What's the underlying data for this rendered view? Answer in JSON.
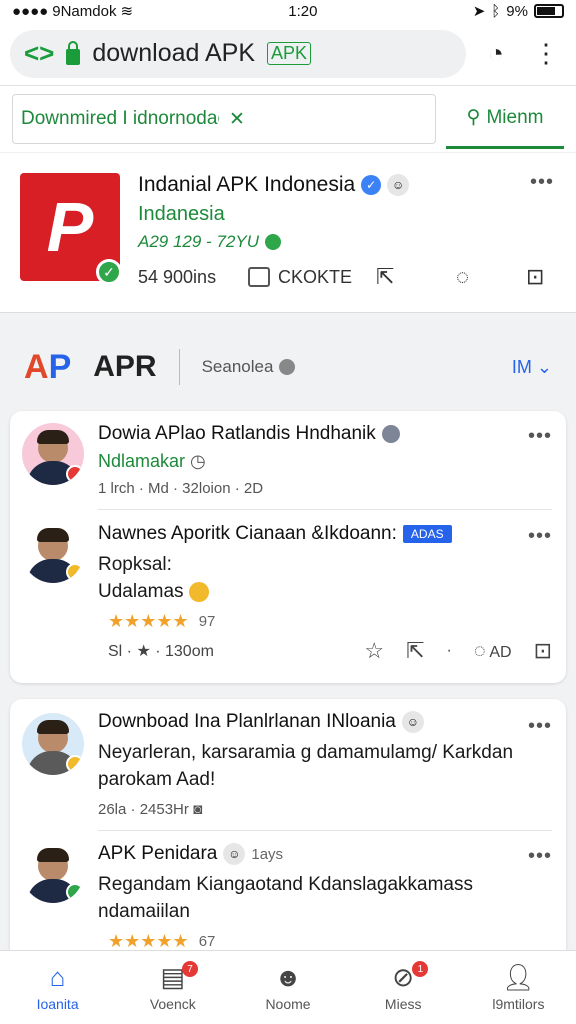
{
  "status_bar": {
    "carrier": "9Namdok",
    "time": "1:20",
    "battery": "9%"
  },
  "browser": {
    "url_text": "download APK",
    "url_tag": "APK"
  },
  "search": {
    "query": "Downmired I idnornodacailaion",
    "tab_label": "Mienm"
  },
  "app_card": {
    "title": "Indanial APK Indonesia",
    "subtitle": "Indanesia",
    "meta": "A29 129 - 72YU",
    "downloads": "54 900ins",
    "comment_label": "CKOKTE"
  },
  "brand": {
    "logo_a": "A",
    "logo_p": "P",
    "name": "APR",
    "subtitle": "Seanolea",
    "lang": "IM"
  },
  "feed": [
    {
      "title": "Dowia APlao Ratlandis Hndhanik",
      "green_text": "Ndlamakar",
      "meta": "1 lrch · Md · 32loion · 2D",
      "avatar_bg": "#f7c9d9",
      "avatar_mini": "#e53935"
    },
    {
      "title": "Nawnes Aporitk Cianaan &Ikdoann:",
      "tag": "ADAS",
      "body1": "Ropksal:",
      "body2": "Udalamas",
      "rating": "97",
      "meta": "Sl · ★ · 130om",
      "comment_count": "AD",
      "avatar_bg": "#ffffff",
      "avatar_mini": "#f2b92a"
    }
  ],
  "feed2": [
    {
      "title": "Downboad Ina Planlrlanan INloania",
      "body": "Neyarleran, karsaramia g damamulamg/ Karkdan parokam Aad!",
      "meta": "26la · 2453Hr",
      "avatar_bg": "#d8e9f7",
      "avatar_mini": "#f2b92a"
    },
    {
      "title": "APK Penidara",
      "time": "1ays",
      "body": "Regandam Kiangaotand Kdanslagakkamass ndamaiilan",
      "rating": "67",
      "avatar_bg": "#ffffff",
      "avatar_mini": "#2fa64a"
    }
  ],
  "bottom_nav": [
    {
      "label": "Ioanita",
      "active": true
    },
    {
      "label": "Voenck",
      "badge": "7"
    },
    {
      "label": "Noome"
    },
    {
      "label": "Miess",
      "badge": "1"
    },
    {
      "label": "l9mtilors"
    }
  ],
  "colors": {
    "accent_green": "#1d8a3b",
    "brand_blue": "#2563eb",
    "app_red": "#d91f26"
  }
}
